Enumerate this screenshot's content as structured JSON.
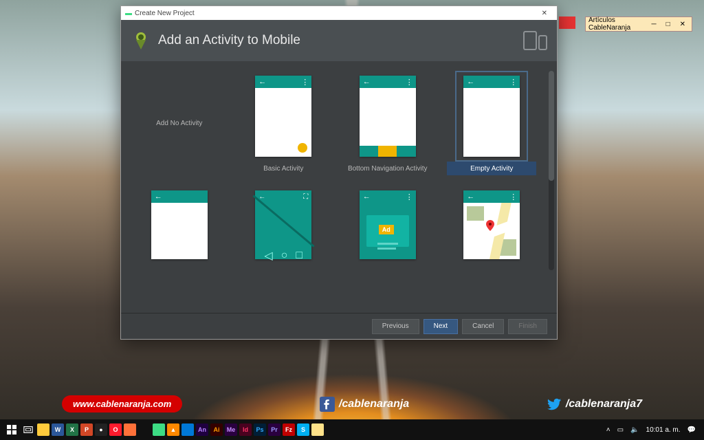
{
  "dialog": {
    "window_title": "Create New Project",
    "header_title": "Add an Activity to Mobile",
    "templates": [
      {
        "label": "Add No Activity",
        "type": "none"
      },
      {
        "label": "Basic Activity",
        "type": "basic"
      },
      {
        "label": "Bottom Navigation Activity",
        "type": "bottomnav"
      },
      {
        "label": "Empty Activity",
        "type": "empty",
        "selected": true
      },
      {
        "label": "",
        "type": "empty2"
      },
      {
        "label": "",
        "type": "fullscreen"
      },
      {
        "label": "",
        "type": "admob"
      },
      {
        "label": "",
        "type": "maps"
      }
    ],
    "buttons": {
      "previous": "Previous",
      "next": "Next",
      "cancel": "Cancel",
      "finish": "Finish"
    }
  },
  "notes_window": {
    "title": "Artículos CableNaranja"
  },
  "footer": {
    "site": "www.cablenaranja.com",
    "fb": "/cablenaranja",
    "tw": "/cablenaranja7"
  },
  "taskbar": {
    "apps": [
      {
        "name": "start",
        "bg": "",
        "txt": ""
      },
      {
        "name": "taskview",
        "bg": "",
        "txt": ""
      },
      {
        "name": "explorer",
        "bg": "#ffcb3c",
        "txt": ""
      },
      {
        "name": "word",
        "bg": "#2b579a",
        "txt": "W"
      },
      {
        "name": "excel",
        "bg": "#217346",
        "txt": "X"
      },
      {
        "name": "powerpoint",
        "bg": "#d24726",
        "txt": "P"
      },
      {
        "name": "obs",
        "bg": "#222",
        "txt": "●"
      },
      {
        "name": "opera",
        "bg": "#ff1b2d",
        "txt": "O"
      },
      {
        "name": "firefox",
        "bg": "#ff7139",
        "txt": ""
      },
      {
        "name": "chrome",
        "bg": "",
        "txt": ""
      },
      {
        "name": "android-studio",
        "bg": "#3ddc84",
        "txt": ""
      },
      {
        "name": "vlc",
        "bg": "#ff8800",
        "txt": "▲"
      },
      {
        "name": "vscode",
        "bg": "#0078d7",
        "txt": ""
      },
      {
        "name": "animate",
        "bg": "#1f0040",
        "txt": "An",
        "fg": "#b380ff"
      },
      {
        "name": "illustrator",
        "bg": "#330000",
        "txt": "Ai",
        "fg": "#ff9a00"
      },
      {
        "name": "media-encoder",
        "bg": "#2a003f",
        "txt": "Me",
        "fg": "#c78fff"
      },
      {
        "name": "indesign",
        "bg": "#49021f",
        "txt": "Id",
        "fg": "#ff3366"
      },
      {
        "name": "photoshop",
        "bg": "#001e36",
        "txt": "Ps",
        "fg": "#31a8ff"
      },
      {
        "name": "premiere",
        "bg": "#2a003f",
        "txt": "Pr",
        "fg": "#9999ff"
      },
      {
        "name": "filezilla",
        "bg": "#bf0000",
        "txt": "Fz"
      },
      {
        "name": "skype",
        "bg": "#00aff0",
        "txt": "S"
      },
      {
        "name": "notes",
        "bg": "#ffe28a",
        "txt": ""
      }
    ],
    "time": "10:01 a. m."
  }
}
